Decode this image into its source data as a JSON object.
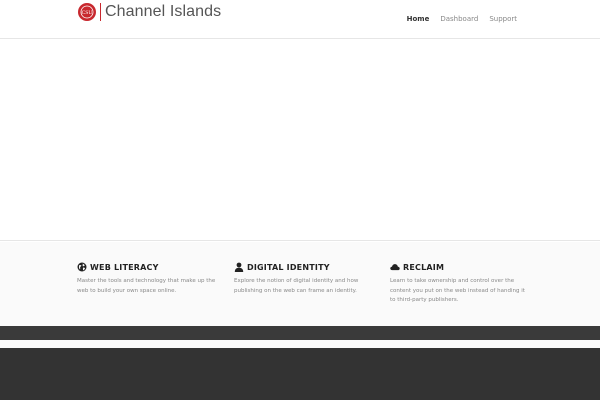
{
  "brand": {
    "name": "Channel Islands",
    "logo_text": "CSU",
    "accent_color": "#c8282e"
  },
  "nav": {
    "items": [
      {
        "label": "Home",
        "active": true
      },
      {
        "label": "Dashboard",
        "active": false
      },
      {
        "label": "Support",
        "active": false
      }
    ]
  },
  "features": [
    {
      "icon": "globe-icon",
      "title": "WEB LITERACY",
      "description": "Master the tools and technology that make up the web to build your own space online."
    },
    {
      "icon": "user-icon",
      "title": "DIGITAL IDENTITY",
      "description": "Explore the notion of digital identity and how publishing on the web can frame an identity."
    },
    {
      "icon": "cloud-icon",
      "title": "RECLAIM",
      "description": "Learn to take ownership and control over the content you put on the web instead of handing it to third-party publishers."
    }
  ]
}
